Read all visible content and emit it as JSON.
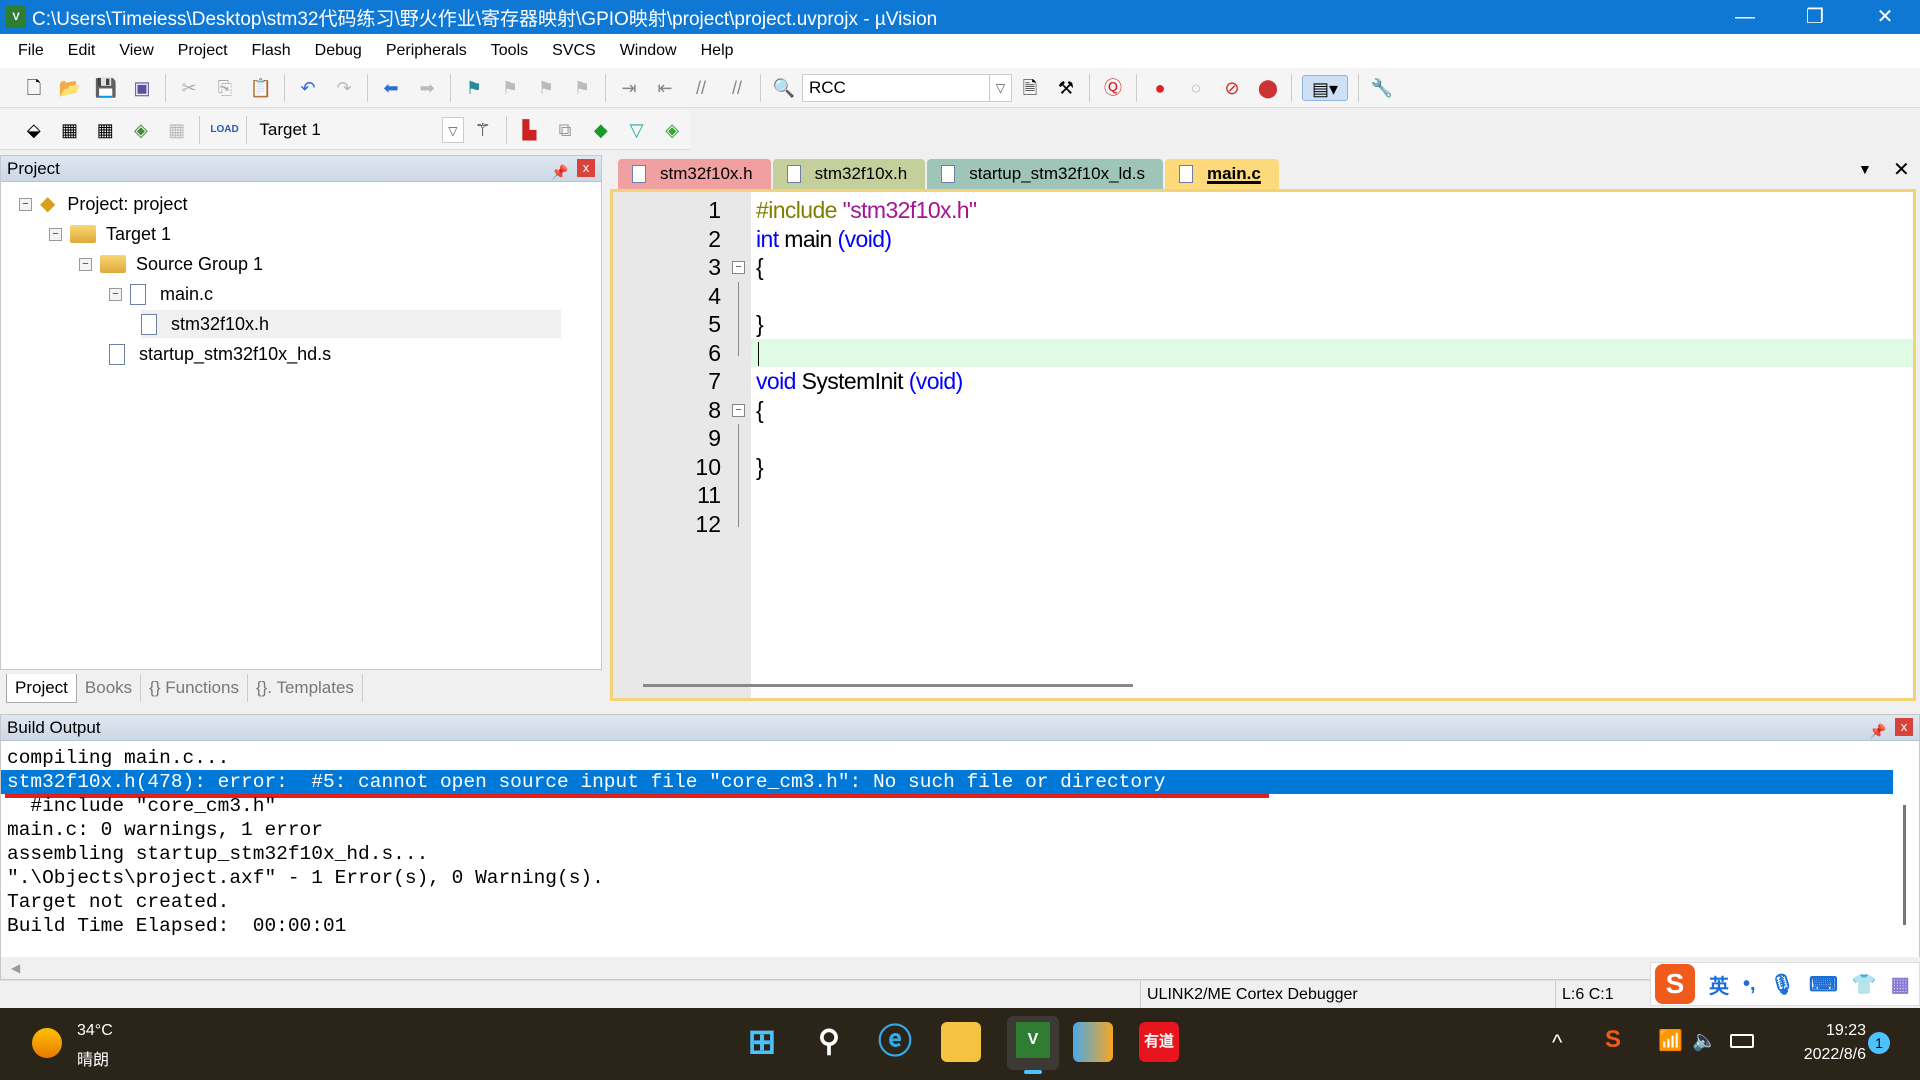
{
  "window": {
    "title": "C:\\Users\\Timeiess\\Desktop\\stm32代码练习\\野火作业\\寄存器映射\\GPIO映射\\project\\project.uvprojx - µVision",
    "minimize": "—",
    "maximize": "❐",
    "close": "✕"
  },
  "menu": [
    "File",
    "Edit",
    "View",
    "Project",
    "Flash",
    "Debug",
    "Peripherals",
    "Tools",
    "SVCS",
    "Window",
    "Help"
  ],
  "toolbar": {
    "find_value": "RCC",
    "target_value": "Target 1"
  },
  "project_panel": {
    "title": "Project",
    "tree": [
      {
        "label": "Project: project",
        "icon": "project-icon"
      },
      {
        "label": "Target 1",
        "icon": "target-folder-icon"
      },
      {
        "label": "Source Group 1",
        "icon": "folder-icon"
      },
      {
        "label": "main.c",
        "icon": "file-icon"
      },
      {
        "label": "stm32f10x.h",
        "icon": "file-icon"
      },
      {
        "label": "startup_stm32f10x_hd.s",
        "icon": "file-icon"
      }
    ],
    "tabs": [
      "Project",
      "Books",
      "{} Functions",
      "{}. Templates"
    ]
  },
  "editor": {
    "tabs": [
      {
        "label": "stm32f10x.h",
        "color": "#f0a0a0"
      },
      {
        "label": "stm32f10x.h",
        "color": "#c4cf9c"
      },
      {
        "label": "startup_stm32f10x_ld.s",
        "color": "#9fc4b8"
      },
      {
        "label": "main.c",
        "color": "#fcd97a",
        "active": true
      }
    ],
    "current_line": 6,
    "lines": [
      [
        {
          "t": "#include ",
          "c": "pp"
        },
        {
          "t": "\"stm32f10x.h\"",
          "c": "st"
        }
      ],
      [
        {
          "t": "int",
          "c": "kw"
        },
        {
          "t": " main "
        },
        {
          "t": "(void)",
          "c": "kw"
        }
      ],
      [
        {
          "t": "{"
        }
      ],
      [],
      [
        {
          "t": "}"
        }
      ],
      [],
      [
        {
          "t": "void",
          "c": "kw"
        },
        {
          "t": " SystemInit "
        },
        {
          "t": "(void)",
          "c": "kw"
        }
      ],
      [
        {
          "t": "{"
        }
      ],
      [],
      [
        {
          "t": "}"
        }
      ],
      [],
      []
    ]
  },
  "build_output": {
    "title": "Build Output",
    "selected_line": 1,
    "lines": [
      "compiling main.c...",
      "stm32f10x.h(478): error:  #5: cannot open source input file \"core_cm3.h\": No such file or directory",
      "  #include \"core_cm3.h\"",
      "main.c: 0 warnings, 1 error",
      "assembling startup_stm32f10x_hd.s...",
      "\".\\Objects\\project.axf\" - 1 Error(s), 0 Warning(s).",
      "Target not created.",
      "Build Time Elapsed:  00:00:01"
    ]
  },
  "status": {
    "debugger": "ULINK2/ME Cortex Debugger",
    "position": "L:6 C:1"
  },
  "ime": {
    "lang": "英",
    "punct": "•,"
  },
  "taskbar": {
    "temp": "34°C",
    "weather": "晴朗",
    "time": "19:23",
    "date": "2022/8/6",
    "notifications": "1",
    "youdao": "有道"
  },
  "colors": {
    "titlebar": "#0f78d4",
    "selection": "#0078d7",
    "current_line": "#e0fbe3",
    "error_underline": "#e02020"
  }
}
